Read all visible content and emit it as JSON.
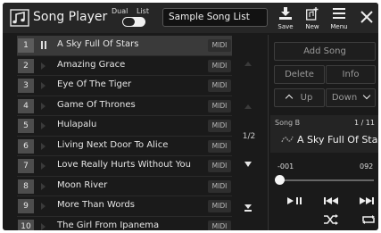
{
  "header": {
    "title": "Song Player",
    "dual_label": "Dual",
    "list_label": "List",
    "list_name": "Sample Song List",
    "save_label": "Save",
    "new_label": "New",
    "menu_label": "Menu"
  },
  "songs": [
    {
      "num": "1",
      "name": "A Sky Full Of Stars",
      "type": "MIDI"
    },
    {
      "num": "2",
      "name": "Amazing Grace",
      "type": "MIDI"
    },
    {
      "num": "3",
      "name": "Eye Of The Tiger",
      "type": "MIDI"
    },
    {
      "num": "4",
      "name": "Game Of Thrones",
      "type": "MIDI"
    },
    {
      "num": "5",
      "name": "Hulapalu",
      "type": "MIDI"
    },
    {
      "num": "6",
      "name": "Living Next Door To Alice",
      "type": "MIDI"
    },
    {
      "num": "7",
      "name": "Love Really Hurts Without You",
      "type": "MIDI"
    },
    {
      "num": "8",
      "name": "Moon River",
      "type": "MIDI"
    },
    {
      "num": "9",
      "name": "More Than Words",
      "type": "MIDI"
    },
    {
      "num": "10",
      "name": "The Girl From Ipanema",
      "type": "MIDI"
    }
  ],
  "pager": {
    "page": "1/2"
  },
  "panel": {
    "add_song": "Add Song",
    "delete": "Delete",
    "info": "Info",
    "up": "Up",
    "down": "Down",
    "song_slot": "Song B",
    "counter": "1 / 11",
    "current_song": "A Sky Full Of Stars",
    "time_start": "-001",
    "time_end": "092",
    "position": 0
  },
  "colors": {
    "background": "#1a1a1a",
    "header": "#262626",
    "selected_row": "#3a3a3a"
  }
}
